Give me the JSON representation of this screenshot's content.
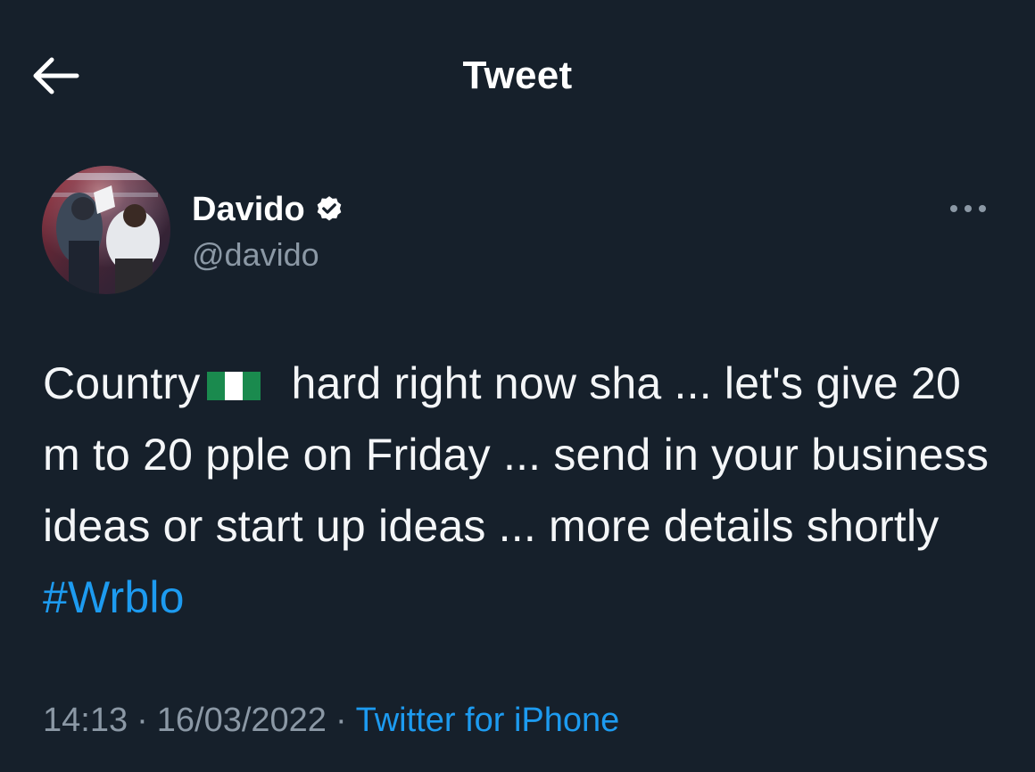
{
  "header": {
    "title": "Tweet",
    "back_icon": "arrow-left-icon"
  },
  "author": {
    "display_name": "Davido",
    "handle": "@davido",
    "verified_icon": "verified-badge-icon",
    "more_icon": "more-horizontal-icon"
  },
  "tweet": {
    "text_part1": "Country",
    "flag_icon": "nigeria-flag-icon",
    "text_part2": "hard right now sha ... let's give 20 m to 20 pple on Friday ... send in your business ideas or start up ideas ... more details shortly ",
    "hashtag": "#Wrblo",
    "time": "14:13",
    "date": "16/03/2022",
    "separator": "·",
    "source": "Twitter for iPhone"
  },
  "colors": {
    "background": "#16202b",
    "accent": "#1d9bf0",
    "secondary_text": "#8b98a5",
    "primary_text": "#ffffff"
  }
}
